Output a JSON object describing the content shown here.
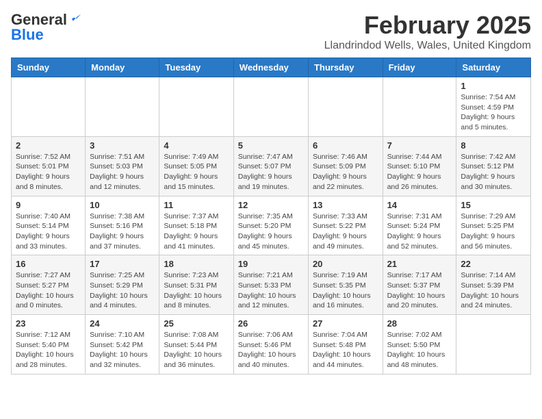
{
  "logo": {
    "general": "General",
    "blue": "Blue"
  },
  "title": "February 2025",
  "subtitle": "Llandrindod Wells, Wales, United Kingdom",
  "headers": [
    "Sunday",
    "Monday",
    "Tuesday",
    "Wednesday",
    "Thursday",
    "Friday",
    "Saturday"
  ],
  "weeks": [
    [
      {
        "day": "",
        "details": ""
      },
      {
        "day": "",
        "details": ""
      },
      {
        "day": "",
        "details": ""
      },
      {
        "day": "",
        "details": ""
      },
      {
        "day": "",
        "details": ""
      },
      {
        "day": "",
        "details": ""
      },
      {
        "day": "1",
        "details": "Sunrise: 7:54 AM\nSunset: 4:59 PM\nDaylight: 9 hours and 5 minutes."
      }
    ],
    [
      {
        "day": "2",
        "details": "Sunrise: 7:52 AM\nSunset: 5:01 PM\nDaylight: 9 hours and 8 minutes."
      },
      {
        "day": "3",
        "details": "Sunrise: 7:51 AM\nSunset: 5:03 PM\nDaylight: 9 hours and 12 minutes."
      },
      {
        "day": "4",
        "details": "Sunrise: 7:49 AM\nSunset: 5:05 PM\nDaylight: 9 hours and 15 minutes."
      },
      {
        "day": "5",
        "details": "Sunrise: 7:47 AM\nSunset: 5:07 PM\nDaylight: 9 hours and 19 minutes."
      },
      {
        "day": "6",
        "details": "Sunrise: 7:46 AM\nSunset: 5:09 PM\nDaylight: 9 hours and 22 minutes."
      },
      {
        "day": "7",
        "details": "Sunrise: 7:44 AM\nSunset: 5:10 PM\nDaylight: 9 hours and 26 minutes."
      },
      {
        "day": "8",
        "details": "Sunrise: 7:42 AM\nSunset: 5:12 PM\nDaylight: 9 hours and 30 minutes."
      }
    ],
    [
      {
        "day": "9",
        "details": "Sunrise: 7:40 AM\nSunset: 5:14 PM\nDaylight: 9 hours and 33 minutes."
      },
      {
        "day": "10",
        "details": "Sunrise: 7:38 AM\nSunset: 5:16 PM\nDaylight: 9 hours and 37 minutes."
      },
      {
        "day": "11",
        "details": "Sunrise: 7:37 AM\nSunset: 5:18 PM\nDaylight: 9 hours and 41 minutes."
      },
      {
        "day": "12",
        "details": "Sunrise: 7:35 AM\nSunset: 5:20 PM\nDaylight: 9 hours and 45 minutes."
      },
      {
        "day": "13",
        "details": "Sunrise: 7:33 AM\nSunset: 5:22 PM\nDaylight: 9 hours and 49 minutes."
      },
      {
        "day": "14",
        "details": "Sunrise: 7:31 AM\nSunset: 5:24 PM\nDaylight: 9 hours and 52 minutes."
      },
      {
        "day": "15",
        "details": "Sunrise: 7:29 AM\nSunset: 5:25 PM\nDaylight: 9 hours and 56 minutes."
      }
    ],
    [
      {
        "day": "16",
        "details": "Sunrise: 7:27 AM\nSunset: 5:27 PM\nDaylight: 10 hours and 0 minutes."
      },
      {
        "day": "17",
        "details": "Sunrise: 7:25 AM\nSunset: 5:29 PM\nDaylight: 10 hours and 4 minutes."
      },
      {
        "day": "18",
        "details": "Sunrise: 7:23 AM\nSunset: 5:31 PM\nDaylight: 10 hours and 8 minutes."
      },
      {
        "day": "19",
        "details": "Sunrise: 7:21 AM\nSunset: 5:33 PM\nDaylight: 10 hours and 12 minutes."
      },
      {
        "day": "20",
        "details": "Sunrise: 7:19 AM\nSunset: 5:35 PM\nDaylight: 10 hours and 16 minutes."
      },
      {
        "day": "21",
        "details": "Sunrise: 7:17 AM\nSunset: 5:37 PM\nDaylight: 10 hours and 20 minutes."
      },
      {
        "day": "22",
        "details": "Sunrise: 7:14 AM\nSunset: 5:39 PM\nDaylight: 10 hours and 24 minutes."
      }
    ],
    [
      {
        "day": "23",
        "details": "Sunrise: 7:12 AM\nSunset: 5:40 PM\nDaylight: 10 hours and 28 minutes."
      },
      {
        "day": "24",
        "details": "Sunrise: 7:10 AM\nSunset: 5:42 PM\nDaylight: 10 hours and 32 minutes."
      },
      {
        "day": "25",
        "details": "Sunrise: 7:08 AM\nSunset: 5:44 PM\nDaylight: 10 hours and 36 minutes."
      },
      {
        "day": "26",
        "details": "Sunrise: 7:06 AM\nSunset: 5:46 PM\nDaylight: 10 hours and 40 minutes."
      },
      {
        "day": "27",
        "details": "Sunrise: 7:04 AM\nSunset: 5:48 PM\nDaylight: 10 hours and 44 minutes."
      },
      {
        "day": "28",
        "details": "Sunrise: 7:02 AM\nSunset: 5:50 PM\nDaylight: 10 hours and 48 minutes."
      },
      {
        "day": "",
        "details": ""
      }
    ]
  ]
}
